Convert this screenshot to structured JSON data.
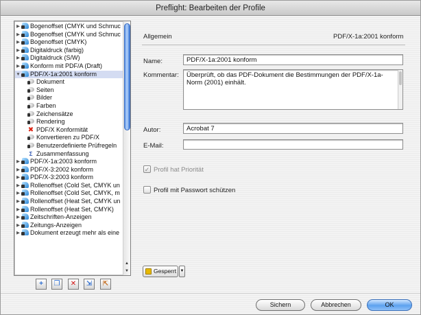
{
  "window": {
    "title": "Preflight: Bearbeiten der Profile"
  },
  "tree": {
    "items": [
      {
        "label": "Bogenoffset (CMYK und Schmuc",
        "type": "profile",
        "expanded": false
      },
      {
        "label": "Bogenoffset (CMYK und Schmuc",
        "type": "profile",
        "expanded": false
      },
      {
        "label": "Bogenoffset (CMYK)",
        "type": "profile",
        "expanded": false
      },
      {
        "label": "Digitaldruck (farbig)",
        "type": "profile",
        "expanded": false
      },
      {
        "label": "Digitaldruck (S/W)",
        "type": "profile",
        "expanded": false
      },
      {
        "label": "Konform mit PDF/A (Draft)",
        "type": "profile",
        "expanded": false
      },
      {
        "label": "PDF/X-1a:2001 konform",
        "type": "profile",
        "expanded": true,
        "selected": true
      },
      {
        "label": "Dokument",
        "type": "sub"
      },
      {
        "label": "Seiten",
        "type": "sub"
      },
      {
        "label": "Bilder",
        "type": "sub"
      },
      {
        "label": "Farben",
        "type": "sub"
      },
      {
        "label": "Zeichensätze",
        "type": "sub"
      },
      {
        "label": "Rendering",
        "type": "sub"
      },
      {
        "label": "PDF/X Konformität",
        "type": "sub-x"
      },
      {
        "label": "Konvertieren zu PDF/X",
        "type": "sub"
      },
      {
        "label": "Benutzerdefinierte Prüfregeln",
        "type": "sub"
      },
      {
        "label": "Zusammenfassung",
        "type": "sub-sum"
      },
      {
        "label": "PDF/X-1a:2003 konform",
        "type": "profile",
        "expanded": false
      },
      {
        "label": "PDF/X-3:2002 konform",
        "type": "profile",
        "expanded": false
      },
      {
        "label": "PDF/X-3:2003 konform",
        "type": "profile",
        "expanded": false
      },
      {
        "label": "Rollenoffset (Cold Set, CMYK un",
        "type": "profile",
        "expanded": false
      },
      {
        "label": "Rollenoffset (Cold Set, CMYK, m",
        "type": "profile",
        "expanded": false
      },
      {
        "label": "Rollenoffset (Heat Set, CMYK un",
        "type": "profile",
        "expanded": false
      },
      {
        "label": "Rollenoffset (Heat Set, CMYK)",
        "type": "profile",
        "expanded": false
      },
      {
        "label": "Zeitschriften-Anzeigen",
        "type": "profile",
        "expanded": false
      },
      {
        "label": "Zeitungs-Anzeigen",
        "type": "profile",
        "expanded": false
      },
      {
        "label": "Dokument erzeugt mehr als eine",
        "type": "profile",
        "expanded": false
      }
    ],
    "buttons": [
      "new-profile-icon",
      "duplicate-icon",
      "delete-icon",
      "import-icon",
      "export-icon"
    ]
  },
  "detail": {
    "section_title": "Allgemein",
    "profile_name_header": "PDF/X-1a:2001 konform",
    "name_label": "Name:",
    "name_value": "PDF/X-1a:2001 konform",
    "comment_label": "Kommentar:",
    "comment_value": "Überprüft, ob das PDF-Dokument die Bestimmungen der PDF/X-1a-Norm (2001) einhält.",
    "author_label": "Autor:",
    "author_value": "Acrobat 7",
    "email_label": "E-Mail:",
    "email_value": "",
    "priority_label": "Profil hat Priorität",
    "priority_checked": true,
    "password_label": "Profil mit Passwort schützen",
    "password_checked": false,
    "lock_label": "Gesperrt"
  },
  "footer": {
    "save_label": "Sichern",
    "cancel_label": "Abbrechen",
    "ok_label": "OK"
  },
  "colors": {
    "selection": "#d4dcf2",
    "accent": "#5da2ef",
    "delete": "#d21111"
  }
}
